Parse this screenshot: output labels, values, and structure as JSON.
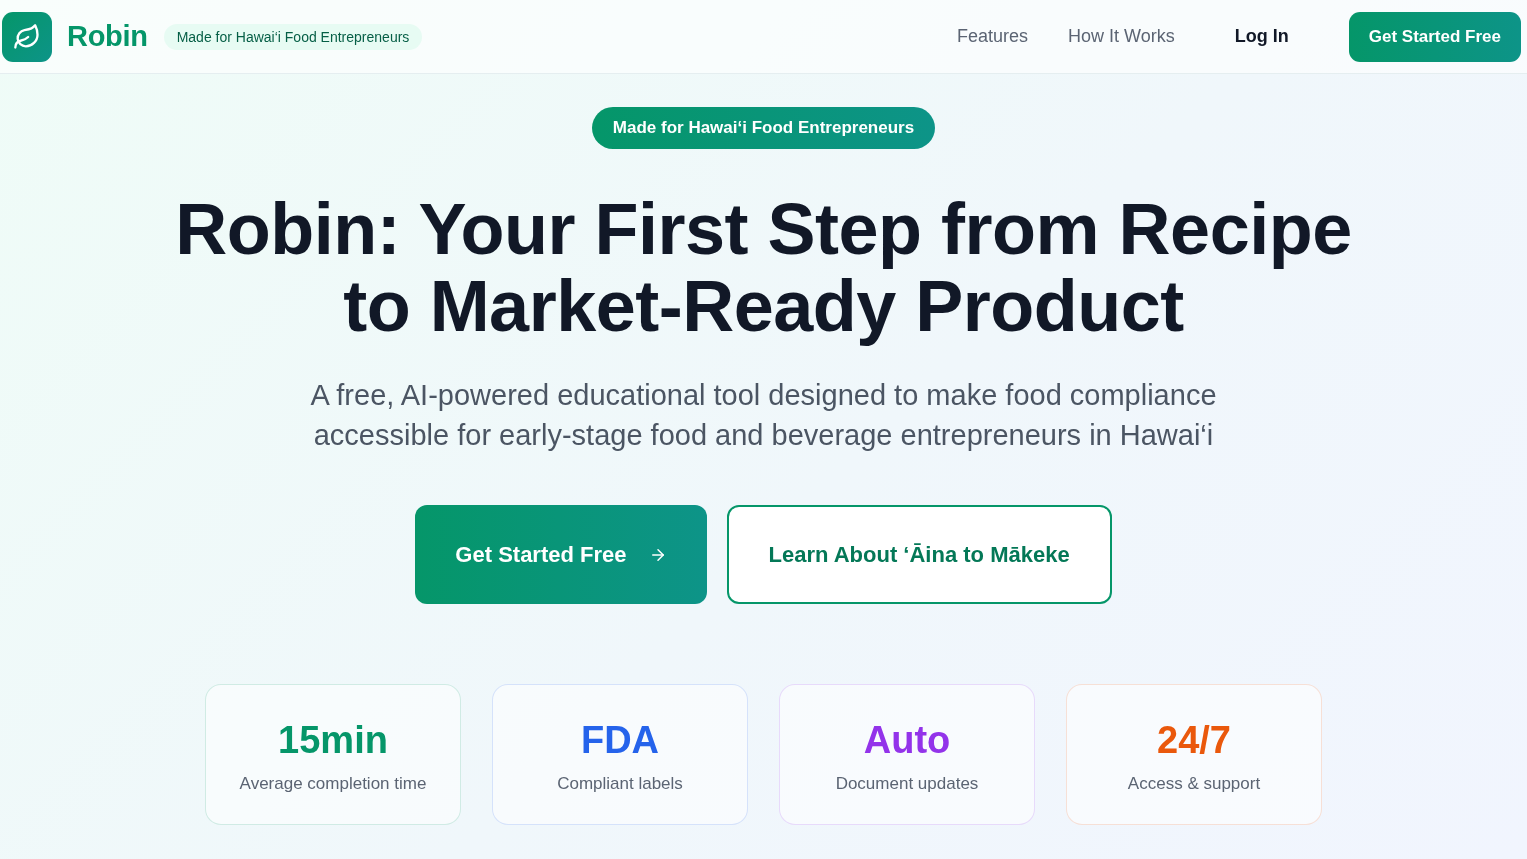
{
  "header": {
    "logo_text": "Robin",
    "badge": "Made for Hawai‘i Food Entrepreneurs",
    "nav": [
      {
        "label": "Features",
        "kind": "link"
      },
      {
        "label": "How It Works",
        "kind": "link"
      },
      {
        "label": "Log In",
        "kind": "login"
      }
    ],
    "cta": "Get Started Free"
  },
  "hero": {
    "pill": "Made for Hawai‘i Food Entrepreneurs",
    "title": "Robin: Your First Step from Recipe to Market-Ready Product",
    "subtitle": "A free, AI-powered educational tool designed to make food compliance accessible for early-stage food and beverage entrepreneurs in Hawai‘i",
    "buttons": [
      {
        "label": "Get Started Free",
        "kind": "primary"
      },
      {
        "label": "Learn About ‘Āina to Mākeke",
        "kind": "outline"
      }
    ]
  },
  "stats": [
    {
      "value": "15min",
      "label": "Average completion time",
      "color": "#059669"
    },
    {
      "value": "FDA",
      "label": "Compliant labels",
      "color": "#2563eb"
    },
    {
      "value": "Auto",
      "label": "Document updates",
      "color": "#9333ea"
    },
    {
      "value": "24/7",
      "label": "Access & support",
      "color": "#ea580c"
    }
  ]
}
